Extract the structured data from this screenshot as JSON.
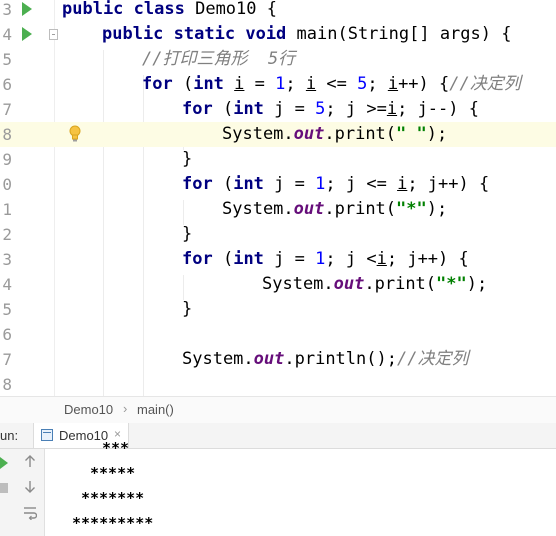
{
  "editor": {
    "line_numbers": [
      "3",
      "4",
      "5",
      "6",
      "7",
      "8",
      "9",
      "0",
      "1",
      "2",
      "3",
      "4",
      "5",
      "6",
      "7",
      "8"
    ],
    "tokens": {
      "public": "public",
      "class": "class",
      "class_name": " Demo10 {",
      "static": "static",
      "void": "void",
      "main_sig": " main(String[] args) {",
      "comment_print": "//打印三角形  5行",
      "for": "for",
      "int": "int",
      "paren_open": " (",
      "i": "i",
      "j": "j",
      "assign": " = ",
      "semi": "; ",
      "le": " <= ",
      "ge": " >=",
      "lt": " <",
      "one": "1",
      "five": "5",
      "i_inc_tail": "++) {",
      "j_dec_tail": "; j--) {",
      "j_inc_tail": "; j++) {",
      "comment_decide": "//决定列",
      "system": "System.",
      "out": "out",
      "print_open": ".print(",
      "println_call": ".println();",
      "space_str": "\" \"",
      "star_str": "\"*\"",
      "close_call": ");",
      "close_brace": "}"
    }
  },
  "breadcrumb": {
    "items": [
      "Demo10",
      "main()"
    ],
    "separator": "›"
  },
  "run_panel": {
    "label": "un:",
    "tab": "Demo10",
    "close": "×",
    "output": [
      "***",
      "*****",
      "*******",
      "*********"
    ]
  },
  "colors": {
    "keyword": "#000080",
    "number": "#0000ff",
    "string": "#008000",
    "field": "#660e7a",
    "comment": "#808080",
    "current_line": "#fdfce4",
    "run_green": "#4caf50"
  },
  "icons": [
    "run-arrow-icon",
    "fold-icon",
    "lightbulb-icon",
    "class-tab-icon",
    "rerun-icon",
    "stop-icon",
    "scroll-up-icon",
    "scroll-down-icon",
    "soft-wrap-icon"
  ]
}
